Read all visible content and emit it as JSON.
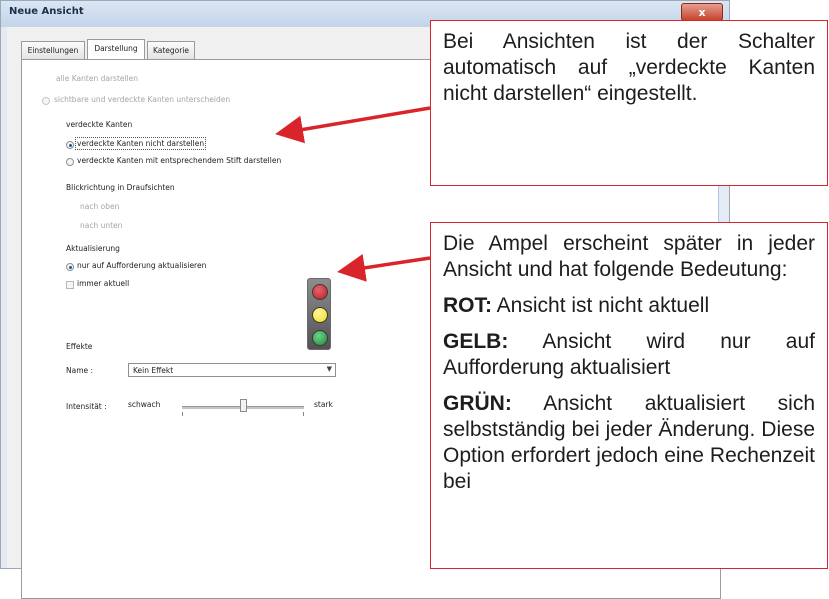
{
  "window": {
    "title": "Neue Ansicht",
    "close_label": "x"
  },
  "tabs": [
    {
      "label": "Einstellungen"
    },
    {
      "label": "Darstellung"
    },
    {
      "label": "Kategorie"
    }
  ],
  "form": {
    "show_all_edges": "alle Kanten darstellen",
    "distinguish_edges": "sichtbare und verdeckte Kanten unterscheiden",
    "hidden_edges_label": "verdeckte Kanten",
    "hidden_edges_opt1": "verdeckte Kanten nicht darstellen",
    "hidden_edges_opt2": "verdeckte Kanten mit entsprechendem Stift darstellen",
    "view_dir_label": "Blickrichtung in Draufsichten",
    "view_dir_up": "nach oben",
    "view_dir_down": "nach unten",
    "update_label": "Aktualisierung",
    "update_opt1": "nur auf Aufforderung aktualisieren",
    "update_opt2": "immer aktuell",
    "effects_label": "Effekte",
    "name_label": "Name :",
    "name_value": "Kein Effekt",
    "intensity_label": "Intensität :",
    "intensity_low": "schwach",
    "intensity_high": "stark",
    "intensity_level": 0.5
  },
  "traffic_light_colors": {
    "red": "#b3202a",
    "yellow": "#f3dd1c",
    "green": "#1f8a3a"
  },
  "notes": {
    "note1": "Bei Ansichten ist der Schalter automatisch auf „verdeckte Kanten nicht darstellen“ eingestellt.",
    "note2_intro": "Die Ampel erscheint später in jeder Ansicht und hat folgende Bedeutung:",
    "rot_label": "ROT:",
    "rot_text": " Ansicht ist nicht aktuell",
    "gelb_label": "GELB:",
    "gelb_text": " Ansicht wird nur auf Aufforderung aktualisiert",
    "gruen_label": "GRÜN:",
    "gruen_text": " Ansicht aktualisiert sich selbstständig bei jeder Änderung. Diese Option erfordert jedoch eine Rechenzeit bei"
  }
}
